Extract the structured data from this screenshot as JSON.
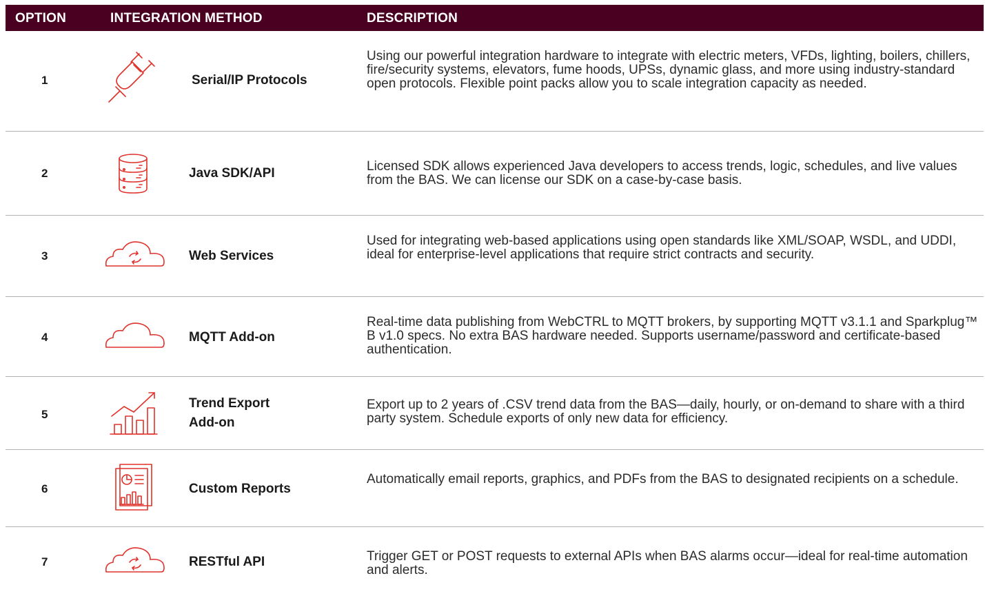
{
  "colors": {
    "header_bg": "#4a0021",
    "icon_red": "#e0312a",
    "separator": "#b3b3b3"
  },
  "header": {
    "option": "OPTION",
    "method": "INTEGRATION METHOD",
    "description": "DESCRIPTION"
  },
  "rows": [
    {
      "option": "1",
      "icon": "plug-icon",
      "method": "Serial/IP Protocols",
      "description": "Using our powerful integration hardware to integrate with electric meters, VFDs, lighting, boilers, chillers, fire/security systems, elevators, fume hoods, UPSs, dynamic glass, and more using industry-standard open protocols. Flexible point packs allow you to scale integration capacity as needed."
    },
    {
      "option": "2",
      "icon": "server-icon",
      "method": "Java SDK/API",
      "description": "Licensed SDK allows experienced Java developers to access trends, logic, schedules, and live values from the BAS. We can license our SDK on a case-by-case basis."
    },
    {
      "option": "3",
      "icon": "cloud-sync-icon",
      "method": "Web Services",
      "description": "Used for integrating web-based applications using open standards like XML/SOAP, WSDL, and UDDI, ideal for enterprise-level applications that require strict contracts and security."
    },
    {
      "option": "4",
      "icon": "cloud-icon",
      "method": "MQTT Add-on",
      "description": "Real-time data publishing from WebCTRL to MQTT brokers, by supporting MQTT v3.1.1 and Sparkplug™ B v1.0 specs. No extra BAS hardware needed. Supports username/password and certificate-based authentication."
    },
    {
      "option": "5",
      "icon": "trend-chart-icon",
      "method": "Trend Export Add-on",
      "description": "Export up to 2 years of .CSV trend data from the BAS—daily, hourly, or on-demand to share with a third party system. Schedule exports of only new data for efficiency."
    },
    {
      "option": "6",
      "icon": "report-icon",
      "method": "Custom Reports",
      "description": "Automatically email reports, graphics, and PDFs from the BAS to designated recipients on a schedule."
    },
    {
      "option": "7",
      "icon": "cloud-sync-icon",
      "method": "RESTful API",
      "description": "Trigger GET or POST requests to external APIs when BAS alarms occur—ideal for real-time automation and alerts."
    }
  ]
}
